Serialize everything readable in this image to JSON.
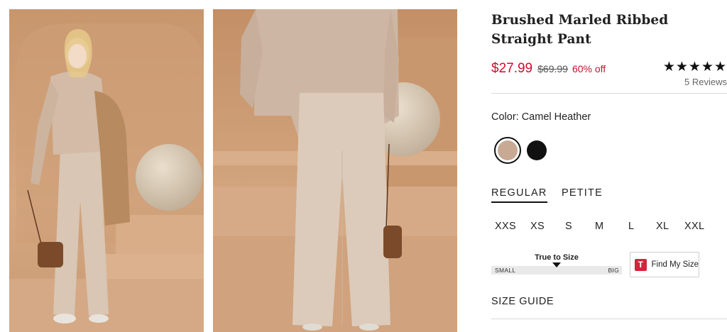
{
  "product": {
    "title": "Brushed Marled Ribbed Straight Pant",
    "price": {
      "sale": "$27.99",
      "original": "$69.99",
      "discount": "60% off",
      "sale_color": "#c8102e"
    },
    "rating": {
      "stars": "★★★★★",
      "value": 5,
      "reviews_label": "5 Reviews"
    }
  },
  "color": {
    "label": "Color: Camel Heather",
    "swatches": [
      {
        "name": "Camel Heather",
        "hex": "#c8a994",
        "selected": true
      },
      {
        "name": "Black",
        "hex": "#111111",
        "selected": false
      }
    ]
  },
  "fit_tabs": [
    {
      "label": "REGULAR",
      "active": true
    },
    {
      "label": "PETITE",
      "active": false
    }
  ],
  "sizes": [
    "XXS",
    "XS",
    "S",
    "M",
    "L",
    "XL",
    "XXL"
  ],
  "fit_meter": {
    "title": "True to Size",
    "left_label": "SMALL",
    "right_label": "BIG",
    "position": 0.5
  },
  "find_my_size": {
    "logo_letter": "T",
    "label": "Find My Size",
    "logo_color": "#d6233d"
  },
  "size_guide": {
    "label": "SIZE GUIDE"
  },
  "images": [
    {
      "name": "front view"
    },
    {
      "name": "back view"
    }
  ]
}
